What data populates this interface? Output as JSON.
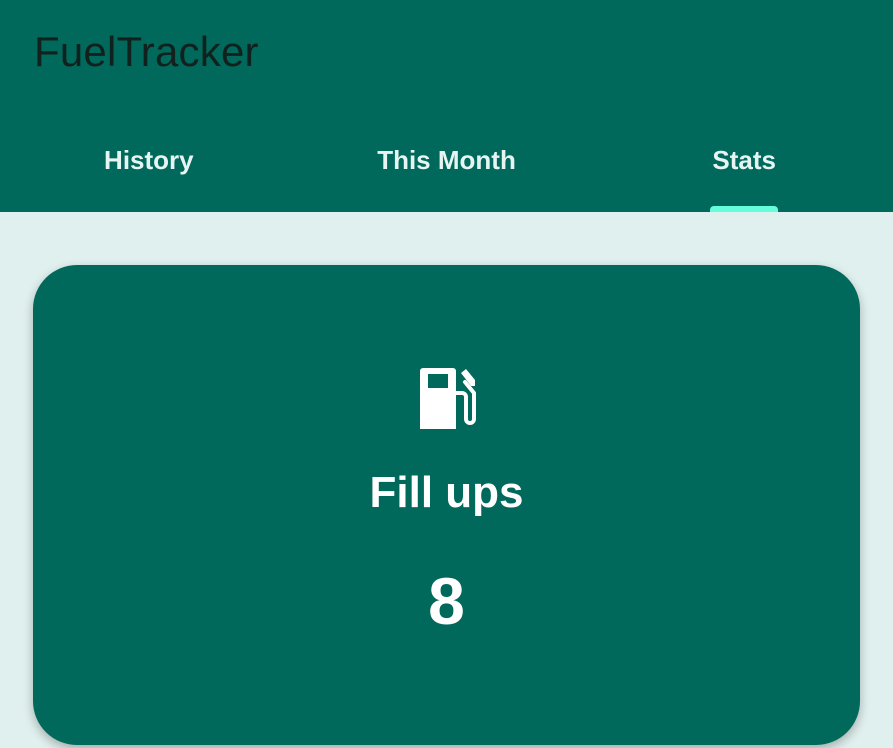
{
  "app": {
    "title": "FuelTracker"
  },
  "tabs": [
    {
      "label": "History",
      "selected": false
    },
    {
      "label": "This Month",
      "selected": false
    },
    {
      "label": "Stats",
      "selected": true
    }
  ],
  "stat_card": {
    "icon": "fuel-pump-icon",
    "label": "Fill ups",
    "value": "8"
  },
  "colors": {
    "primary": "#00695c",
    "background": "#e0f0ee",
    "indicator": "#64ffda",
    "text_on_primary": "#ffffff"
  }
}
